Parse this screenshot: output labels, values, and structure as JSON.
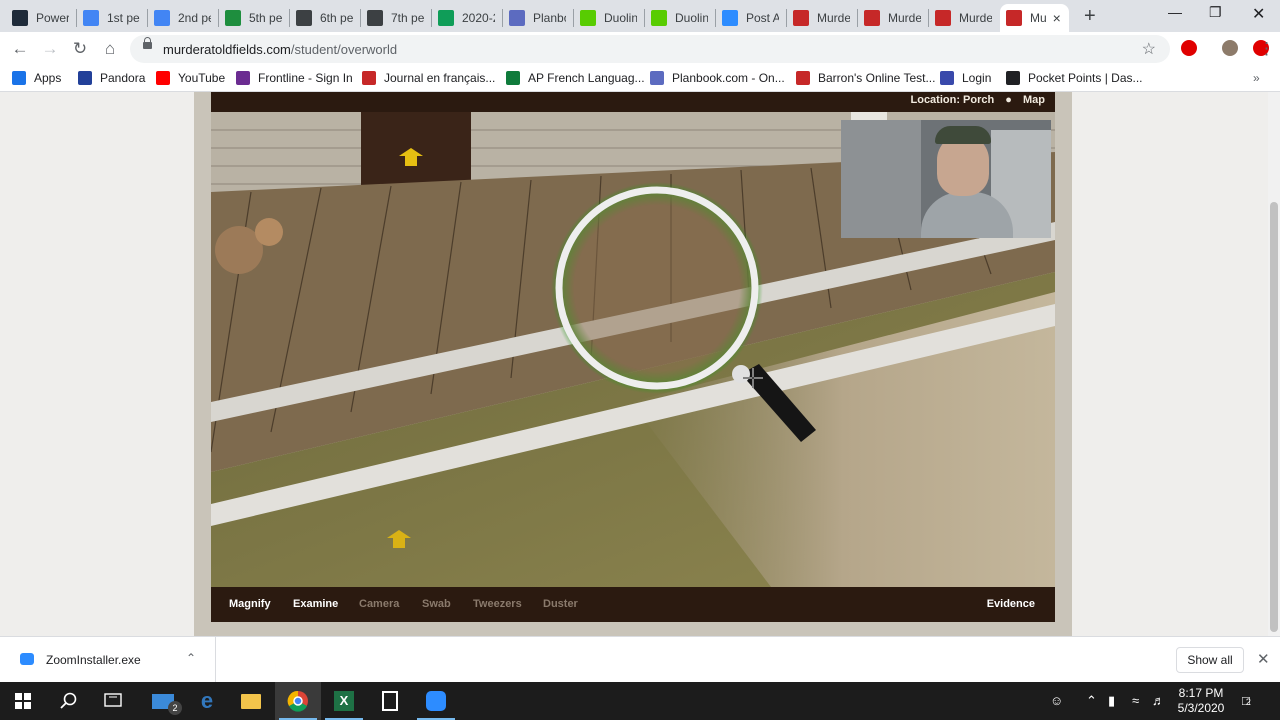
{
  "tabs": [
    {
      "title": "Power",
      "icon": "tab-icon-p",
      "color": "#1f2b3a"
    },
    {
      "title": "1st pe",
      "icon": "tab-icon-meet",
      "color": "#4285f4"
    },
    {
      "title": "2nd pe",
      "icon": "tab-icon-meet",
      "color": "#4285f4"
    },
    {
      "title": "5th pe",
      "icon": "tab-icon-classroom",
      "color": "#1e8e3e"
    },
    {
      "title": "6th pe",
      "icon": "tab-icon-doc",
      "color": "#3c4043"
    },
    {
      "title": "7th pe",
      "icon": "tab-icon-doc",
      "color": "#3c4043"
    },
    {
      "title": "2020-2",
      "icon": "tab-icon-sheets",
      "color": "#0f9d58"
    },
    {
      "title": "Planbo",
      "icon": "tab-icon-planbook",
      "color": "#5c6bc0"
    },
    {
      "title": "Duolin",
      "icon": "tab-icon-duolingo",
      "color": "#58cc02"
    },
    {
      "title": "Duolin",
      "icon": "tab-icon-duolingo",
      "color": "#58cc02"
    },
    {
      "title": "Post A",
      "icon": "tab-icon-zoom",
      "color": "#2d8cff"
    },
    {
      "title": "Murde",
      "icon": "tab-icon-murder",
      "color": "#c62828"
    },
    {
      "title": "Murde",
      "icon": "tab-icon-murder",
      "color": "#c62828"
    },
    {
      "title": "Murde",
      "icon": "tab-icon-murder",
      "color": "#c62828"
    },
    {
      "title": "Mu",
      "icon": "tab-icon-murder",
      "color": "#c62828",
      "active": true
    }
  ],
  "toolbar": {
    "url_host": "murderatoldfields.com",
    "url_path": "/student/overworld"
  },
  "bookmarks": [
    {
      "label": "Apps",
      "icon": "apps-grid-icon",
      "color": "#1a73e8"
    },
    {
      "label": "Pandora",
      "icon": "pandora-icon",
      "color": "#224099"
    },
    {
      "label": "YouTube",
      "icon": "youtube-icon",
      "color": "#ff0000"
    },
    {
      "label": "Frontline - Sign In",
      "icon": "frontline-icon",
      "color": "#6b2c91"
    },
    {
      "label": "Journal en français...",
      "icon": "journal-icon",
      "color": "#c62828"
    },
    {
      "label": "AP French Languag...",
      "icon": "ap-icon",
      "color": "#0f7b3b"
    },
    {
      "label": "Planbook.com - On...",
      "icon": "planbook-icon",
      "color": "#5c6bc0"
    },
    {
      "label": "Barron's Online Test...",
      "icon": "barrons-icon",
      "color": "#c62828"
    },
    {
      "label": "Login",
      "icon": "login-icon",
      "color": "#3949ab"
    },
    {
      "label": "Pocket Points | Das...",
      "icon": "pocketpoints-icon",
      "color": "#202124"
    }
  ],
  "game": {
    "location_label": "Location: Porch",
    "map_label": "Map",
    "tools": [
      {
        "label": "Magnify",
        "enabled": true
      },
      {
        "label": "Examine",
        "enabled": true
      },
      {
        "label": "Camera",
        "enabled": false
      },
      {
        "label": "Swab",
        "enabled": false
      },
      {
        "label": "Tweezers",
        "enabled": false
      },
      {
        "label": "Duster",
        "enabled": false
      }
    ],
    "evidence_label": "Evidence",
    "colors": {
      "enabled": "#ffffff",
      "disabled": "#8a7a6c",
      "bar": "#2b1a10"
    }
  },
  "downloads": {
    "file_name": "ZoomInstaller.exe",
    "show_all": "Show all"
  },
  "taskbar": {
    "time": "8:17 PM",
    "date": "5/3/2020",
    "mail_badge": "2",
    "notification_badge": "2"
  }
}
